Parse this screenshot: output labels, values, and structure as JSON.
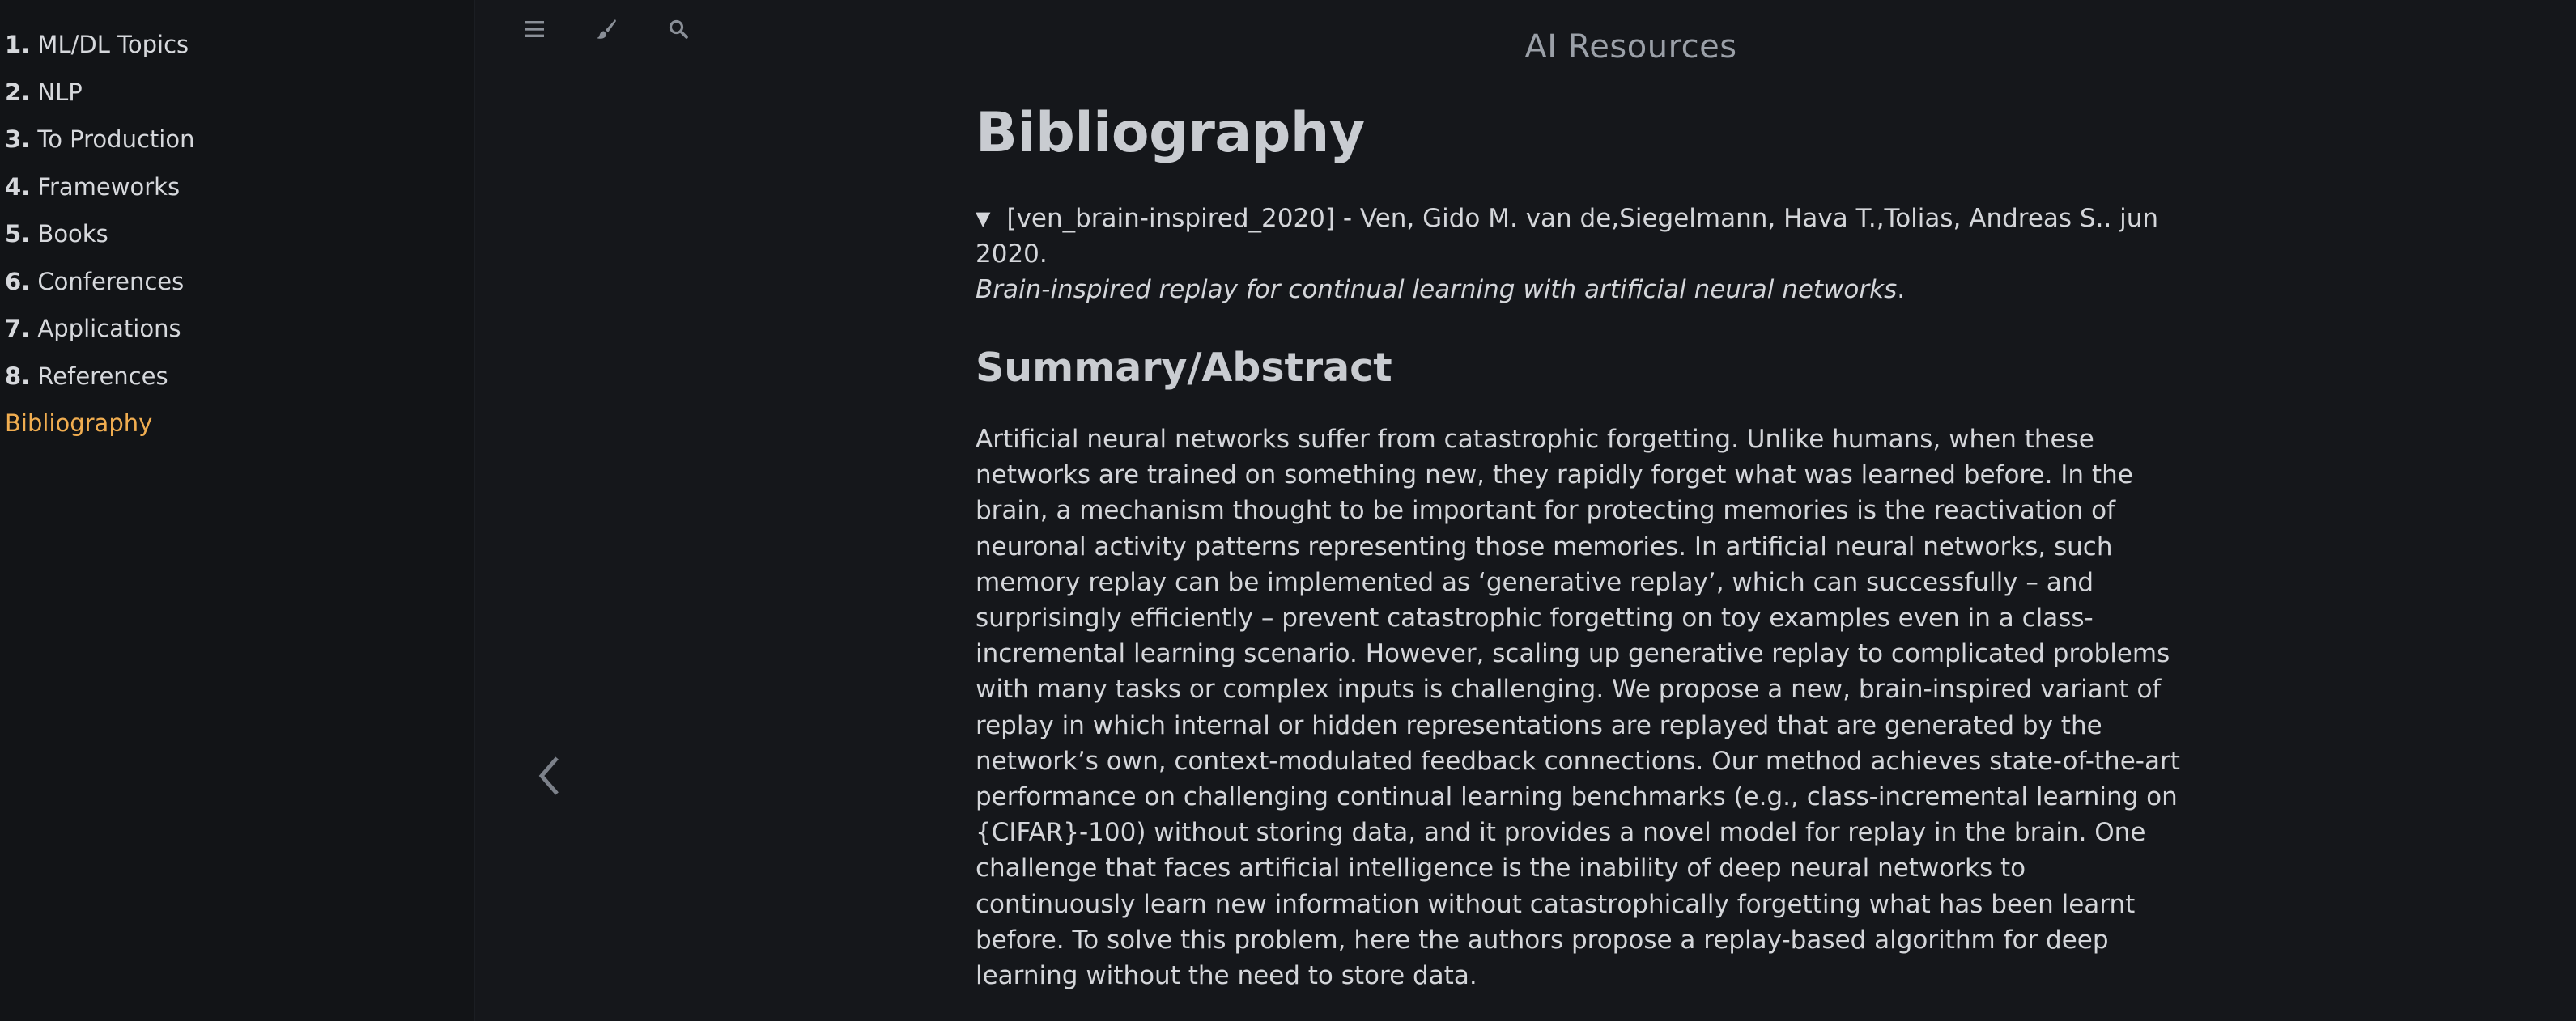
{
  "sidebar": {
    "items": [
      {
        "num": "1.",
        "label": "ML/DL Topics"
      },
      {
        "num": "2.",
        "label": "NLP"
      },
      {
        "num": "3.",
        "label": "To Production"
      },
      {
        "num": "4.",
        "label": "Frameworks"
      },
      {
        "num": "5.",
        "label": "Books"
      },
      {
        "num": "6.",
        "label": "Conferences"
      },
      {
        "num": "7.",
        "label": "Applications"
      },
      {
        "num": "8.",
        "label": "References"
      },
      {
        "num": "",
        "label": "Bibliography",
        "active": true
      }
    ]
  },
  "topbar": {
    "book_title": "AI Resources",
    "icons": [
      "menu-icon",
      "paintbrush-icon",
      "search-icon"
    ]
  },
  "nav": {
    "prev_icon": "chevron-left-icon"
  },
  "page": {
    "title": "Bibliography",
    "entry": {
      "toggle_glyph": "▼",
      "citation": "[ven_brain-inspired_2020] - Ven, Gido M. van de,Siegelmann, Hava T.,Tolias, Andreas S.. jun 2020.",
      "paper_title": "Brain-inspired replay for continual learning with artificial neural networks",
      "trailing": "."
    },
    "section_heading": "Summary/Abstract",
    "abstract": "Artificial neural networks suffer from catastrophic forgetting. Unlike humans, when these networks are trained on something new, they rapidly forget what was learned before. In the brain, a mechanism thought to be important for protecting memories is the reactivation of neuronal activity patterns representing those memories. In artificial neural networks, such memory replay can be implemented as ‘generative replay’, which can successfully – and surprisingly efficiently – prevent catastrophic forgetting on toy examples even in a class-incremental learning scenario. However, scaling up generative replay to complicated problems with many tasks or complex inputs is challenging. We propose a new, brain-inspired variant of replay in which internal or hidden representations are replayed that are generated by the network’s own, context-modulated feedback connections. Our method achieves state-of-the-art performance on challenging continual learning benchmarks (e.g., class-incremental learning on {CIFAR}-100) without storing data, and it provides a novel model for replay in the brain. One challenge that faces artificial intelligence is the inability of deep neural networks to continuously learn new information without catastrophically forgetting what has been learnt before. To solve this problem, here the authors propose a replay-based algorithm for deep learning without the need to store data."
  },
  "colors": {
    "background": "#15171b",
    "sidebar_bg": "#121417",
    "text": "#d4d6da",
    "active_link": "#f0ad50",
    "icon": "#8a8f97"
  }
}
